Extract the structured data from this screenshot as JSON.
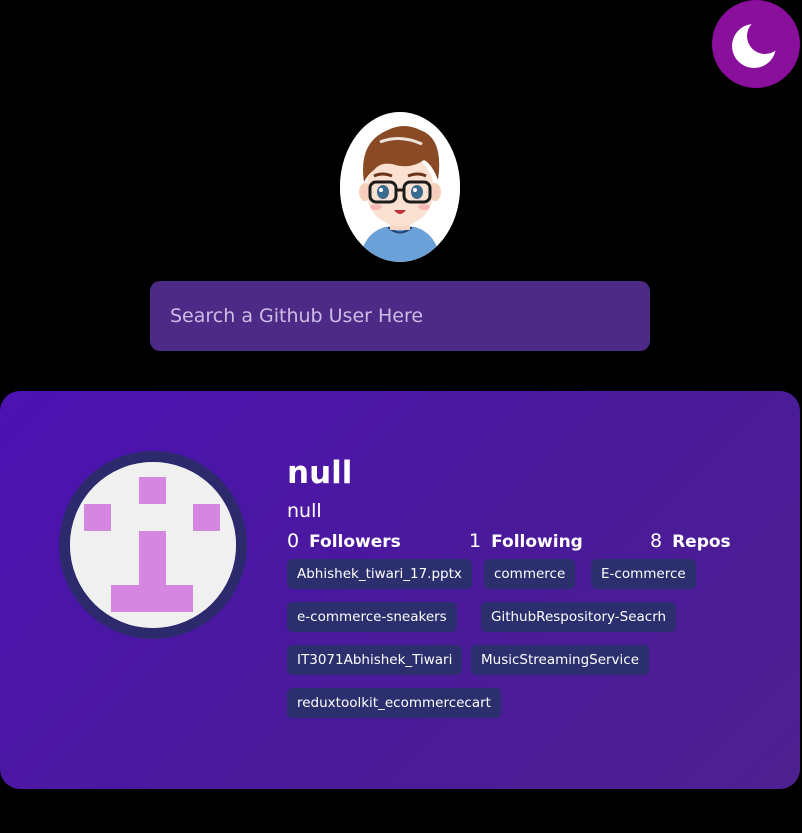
{
  "theme": {
    "toggle_icon": "moon-icon",
    "toggle_color": "#8a0f9c"
  },
  "search": {
    "placeholder": "Search a Github User Here",
    "value": ""
  },
  "user": {
    "name": "null",
    "login": "null",
    "stats": [
      {
        "value": "0",
        "label": "Followers"
      },
      {
        "value": "1",
        "label": "Following"
      },
      {
        "value": "8",
        "label": "Repos"
      }
    ],
    "repos": [
      "Abhishek_tiwari_17.pptx",
      "commerce",
      "E-commerce",
      "e-commerce-sneakers",
      "GithubRespository-Seacrh",
      "IT3071Abhishek_Tiwari",
      "MusicStreamingService",
      "reduxtoolkit_ecommercecart"
    ]
  },
  "colors": {
    "background": "#000000",
    "card_gradient_start": "#4c12b3",
    "card_gradient_end": "#4d2090",
    "search_bg": "#4c2a86",
    "chip_bg": "#2b2f6e",
    "identicon_fg": "#d387df",
    "identicon_ring": "#2c2a6c"
  }
}
